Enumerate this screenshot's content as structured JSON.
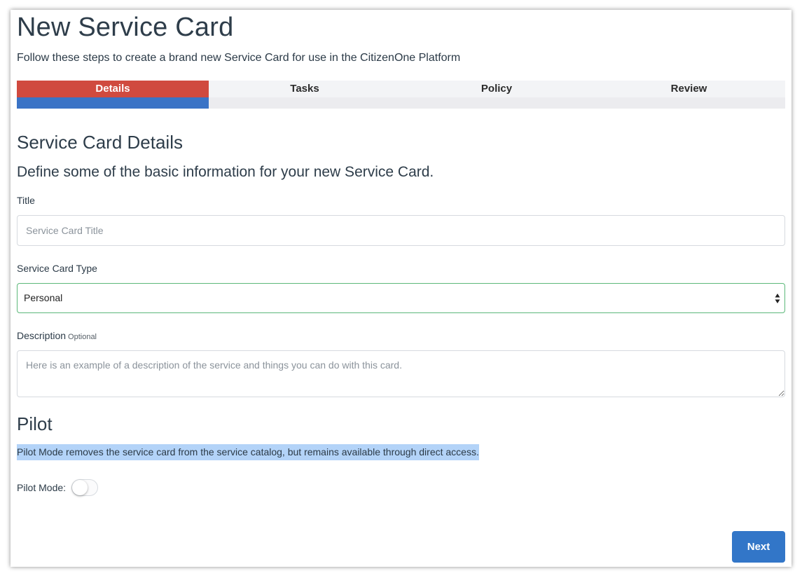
{
  "header": {
    "title": "New Service Card",
    "subtitle": "Follow these steps to create a brand new Service Card for use in the CitizenOne Platform"
  },
  "stepper": {
    "steps": [
      {
        "label": "Details",
        "active": true
      },
      {
        "label": "Tasks",
        "active": false
      },
      {
        "label": "Policy",
        "active": false
      },
      {
        "label": "Review",
        "active": false
      }
    ],
    "progress_fraction": 0.25,
    "colors": {
      "active_step": "#d04a3f",
      "progress": "#3a73c6"
    }
  },
  "details": {
    "section_title": "Service Card Details",
    "section_subtitle": "Define some of the basic information for your new Service Card.",
    "title_field": {
      "label": "Title",
      "placeholder": "Service Card Title",
      "value": ""
    },
    "type_field": {
      "label": "Service Card Type",
      "selected": "Personal",
      "icon": "select-arrows-icon"
    },
    "description_field": {
      "label": "Description",
      "optional_tag": "Optional",
      "placeholder": "Here is an example of a description of the service and things you can do with this card.",
      "value": ""
    }
  },
  "pilot": {
    "section_title": "Pilot",
    "description": "Pilot Mode removes the service card from the service catalog, but remains available through direct access.",
    "toggle_label": "Pilot Mode:",
    "toggle_on": false
  },
  "footer": {
    "next_label": "Next",
    "button_color": "#3276c8"
  }
}
